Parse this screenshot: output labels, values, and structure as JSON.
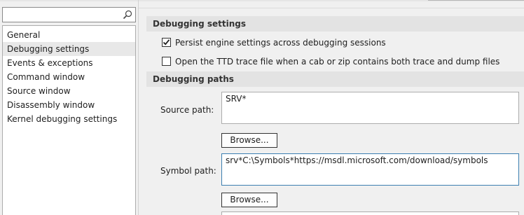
{
  "search": {
    "placeholder": "",
    "value": ""
  },
  "nav": {
    "items": [
      {
        "label": "General"
      },
      {
        "label": "Debugging settings"
      },
      {
        "label": "Events & exceptions"
      },
      {
        "label": "Command window"
      },
      {
        "label": "Source window"
      },
      {
        "label": "Disassembly window"
      },
      {
        "label": "Kernel debugging settings"
      }
    ],
    "selected_index": 1
  },
  "debugging_settings": {
    "header": "Debugging settings",
    "options": [
      {
        "label": "Persist engine settings across debugging sessions",
        "checked": true
      },
      {
        "label": "Open the TTD trace file when a cab or zip contains both trace and dump files",
        "checked": false
      }
    ]
  },
  "debugging_paths": {
    "header": "Debugging paths",
    "source_path": {
      "label": "Source path:",
      "value": "SRV*",
      "browse_label": "Browse..."
    },
    "symbol_path": {
      "label": "Symbol path:",
      "value": "srv*C:\\Symbols*https://msdl.microsoft.com/download/symbols",
      "browse_label": "Browse..."
    }
  },
  "colors": {
    "window_bg": "#f0f0f0",
    "section_header_bg": "#e3e3e3",
    "selected_item_bg": "#e8e8e8",
    "focus_border": "#3c7fb1"
  },
  "icons": {
    "search": "search-icon",
    "checkmark": "checkmark-icon"
  }
}
